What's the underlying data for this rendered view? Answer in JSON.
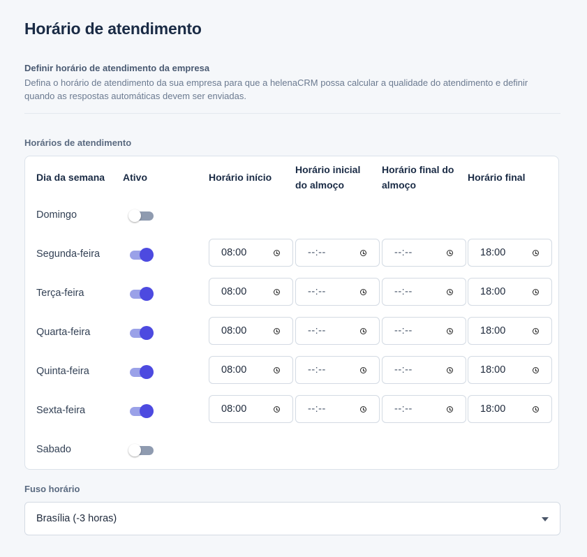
{
  "page": {
    "title": "Horário de atendimento",
    "subtitle": "Definir horário de atendimento da empresa",
    "description": "Defina o horário de atendimento da sua empresa para que a helenaCRM possa calcular a qualidade do atendimento e definir quando as respostas automáticas devem ser enviadas."
  },
  "schedule": {
    "section_label": "Horários de atendimento",
    "headers": {
      "day": "Dia da semana",
      "active": "Ativo",
      "start": "Horário início",
      "lunch_start_1": "Horário inicial",
      "lunch_start_2": "do almoço",
      "lunch_end_1": "Horário final do",
      "lunch_end_2": "almoço",
      "end": "Horário final"
    },
    "rows": [
      {
        "day": "Domingo",
        "active": false
      },
      {
        "day": "Segunda-feira",
        "active": true,
        "start": "08:00",
        "lunch_start": "--:--",
        "lunch_end": "--:--",
        "end": "18:00"
      },
      {
        "day": "Terça-feira",
        "active": true,
        "start": "08:00",
        "lunch_start": "--:--",
        "lunch_end": "--:--",
        "end": "18:00"
      },
      {
        "day": "Quarta-feira",
        "active": true,
        "start": "08:00",
        "lunch_start": "--:--",
        "lunch_end": "--:--",
        "end": "18:00"
      },
      {
        "day": "Quinta-feira",
        "active": true,
        "start": "08:00",
        "lunch_start": "--:--",
        "lunch_end": "--:--",
        "end": "18:00"
      },
      {
        "day": "Sexta-feira",
        "active": true,
        "start": "08:00",
        "lunch_start": "--:--",
        "lunch_end": "--:--",
        "end": "18:00"
      },
      {
        "day": "Sabado",
        "active": false
      }
    ]
  },
  "timezone": {
    "label": "Fuso horário",
    "value": "Brasília (-3 horas)"
  },
  "colors": {
    "accent": "#4d4ae0",
    "toggle_track_on": "#9aa1e8",
    "toggle_track_off": "#8f9bb0"
  }
}
